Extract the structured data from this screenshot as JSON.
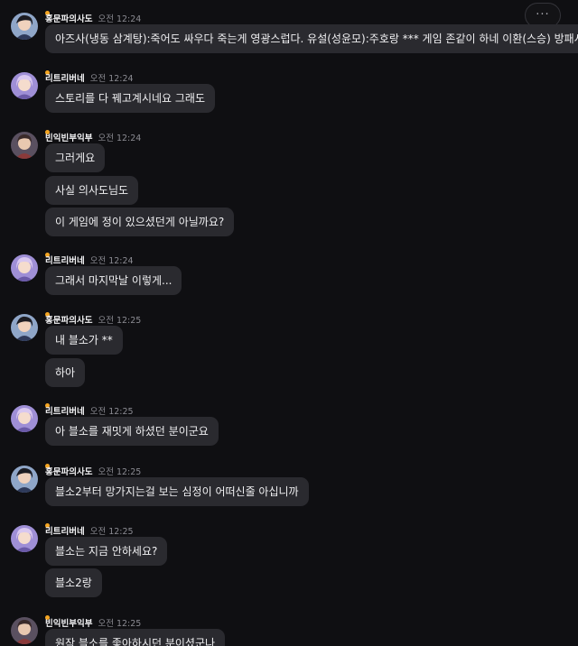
{
  "header": {
    "more_label": "···"
  },
  "colors": {
    "background": "#0f0f12",
    "bubble": "#2a2a2f",
    "online_dot": "#f5a623",
    "time_text": "#8b8b92"
  },
  "messages": [
    {
      "user": "홍문파의사도",
      "avatar_icon": "warrior-avatar-icon",
      "time": "오전 12:24",
      "lines": [
        "아즈사(냉동 삼계탕):죽어도 싸우다 죽는게 영광스럽다. 유설(성윤모):주호랑 *** 게임 존같이 하네 이환(스승) 방패시전"
      ]
    },
    {
      "user": "리트리버네",
      "avatar_icon": "girl-avatar-icon",
      "time": "오전 12:24",
      "lines": [
        "스토리를 다 꿰고계시네요 그래도"
      ]
    },
    {
      "user": "빈익빈부익부",
      "avatar_icon": "character-avatar-icon",
      "time": "오전 12:24",
      "lines": [
        "그러게요",
        "사실 의사도님도",
        "이 게임에 정이 있으셨던게 아닐까요?"
      ]
    },
    {
      "user": "리트리버네",
      "avatar_icon": "girl-avatar-icon",
      "time": "오전 12:24",
      "lines": [
        "그래서 마지막날 이렇게..."
      ]
    },
    {
      "user": "홍문파의사도",
      "avatar_icon": "warrior-avatar-icon",
      "time": "오전 12:25",
      "lines": [
        "내 블소가 **",
        "하아"
      ]
    },
    {
      "user": "리트리버네",
      "avatar_icon": "girl-avatar-icon",
      "time": "오전 12:25",
      "lines": [
        "아 블소를 재밋게 하셨던 분이군요"
      ]
    },
    {
      "user": "홍문파의사도",
      "avatar_icon": "warrior-avatar-icon",
      "time": "오전 12:25",
      "lines": [
        "블소2부터 망가지는걸 보는 심정이 어떠신줄 아십니까"
      ]
    },
    {
      "user": "리트리버네",
      "avatar_icon": "girl-avatar-icon",
      "time": "오전 12:25",
      "lines": [
        "블소는 지금 안하세요?",
        "블소2랑"
      ]
    },
    {
      "user": "빈익빈부익부",
      "avatar_icon": "character-avatar-icon",
      "time": "오전 12:25",
      "lines": [
        "원작 블소를 좋아하시던 분이셨군나"
      ]
    }
  ]
}
